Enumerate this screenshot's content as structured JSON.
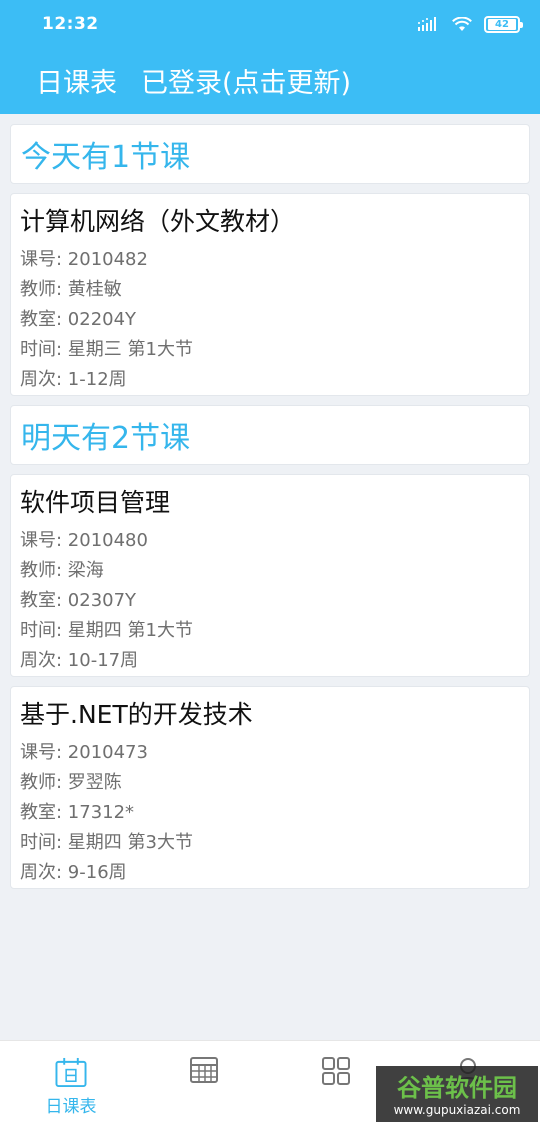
{
  "status_bar": {
    "time": "12:32",
    "battery": "42",
    "icons": [
      "signal-icon",
      "wifi-icon",
      "battery-icon"
    ]
  },
  "header": {
    "title": "日课表",
    "login_status": "已登录(点击更新)",
    "color": "#3cbdf5"
  },
  "sections": [
    {
      "title": "今天有1节课",
      "courses": [
        {
          "name": "计算机网络（外文教材）",
          "rows": [
            {
              "k": "课号",
              "v": "2010482"
            },
            {
              "k": "教师",
              "v": "黄桂敏"
            },
            {
              "k": "教室",
              "v": "02204Y"
            },
            {
              "k": "时间",
              "v": "星期三 第1大节"
            },
            {
              "k": "周次",
              "v": "1-12周"
            }
          ]
        }
      ]
    },
    {
      "title": "明天有2节课",
      "courses": [
        {
          "name": "软件项目管理",
          "rows": [
            {
              "k": "课号",
              "v": "2010480"
            },
            {
              "k": "教师",
              "v": "梁海"
            },
            {
              "k": "教室",
              "v": "02307Y"
            },
            {
              "k": "时间",
              "v": "星期四 第1大节"
            },
            {
              "k": "周次",
              "v": "10-17周"
            }
          ]
        },
        {
          "name": "基于.NET的开发技术",
          "rows": [
            {
              "k": "课号",
              "v": "2010473"
            },
            {
              "k": "教师",
              "v": "罗翌陈"
            },
            {
              "k": "教室",
              "v": "17312*"
            },
            {
              "k": "时间",
              "v": "星期四 第3大节"
            },
            {
              "k": "周次",
              "v": "9-16周"
            }
          ]
        }
      ]
    }
  ],
  "bottom_nav": {
    "active_label": "日课表",
    "items": [
      "calendar-day-icon",
      "table-grid-icon",
      "apps-grid-icon",
      "user-icon"
    ]
  },
  "watermark": {
    "brand": "谷普软件园",
    "url": "www.gupuxiazai.com"
  },
  "accent_color": "#35b6ec"
}
